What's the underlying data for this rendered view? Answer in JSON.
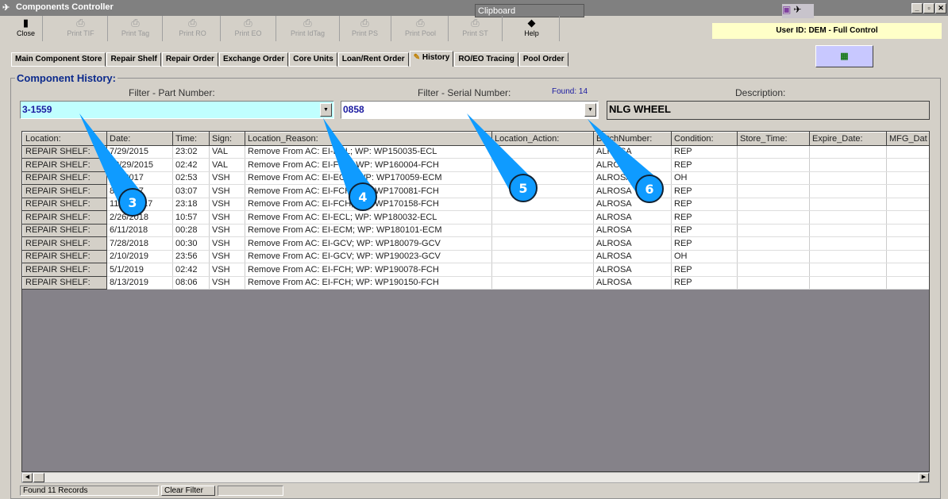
{
  "window": {
    "title": "Components Controller",
    "clipboard": "Clipboard",
    "minimize": "_",
    "restore": "▫",
    "close": "✕"
  },
  "toolbar": [
    {
      "label": "Close",
      "icon": "door-icon",
      "enabled": true
    },
    {
      "label": "Print TIF",
      "icon": "printer-icon",
      "enabled": false
    },
    {
      "label": "Print Tag",
      "icon": "printer-icon",
      "enabled": false
    },
    {
      "label": "Print RO",
      "icon": "printer-icon",
      "enabled": false
    },
    {
      "label": "Print EO",
      "icon": "printer-icon",
      "enabled": false
    },
    {
      "label": "Print IdTag",
      "icon": "printer-icon",
      "enabled": false
    },
    {
      "label": "Print PS",
      "icon": "printer-icon",
      "enabled": false
    },
    {
      "label": "Print Pool",
      "icon": "printer-icon",
      "enabled": false
    },
    {
      "label": "Print ST",
      "icon": "printer-icon",
      "enabled": false
    },
    {
      "label": "Help",
      "icon": "help-book-icon",
      "enabled": true
    }
  ],
  "user": "User ID: DEM - Full Control",
  "tabs": [
    "Main Component Store",
    "Repair Shelf",
    "Repair Order",
    "Exchange Order",
    "Core Units",
    "Loan/Rent Order",
    "History",
    "RO/EO Tracing",
    "Pool Order"
  ],
  "active_tab": "History",
  "group_title": "Component History:",
  "filters": {
    "part_label": "Filter - Part Number:",
    "part_value": "3-1559",
    "serial_label": "Filter - Serial Number:",
    "serial_value": "0858",
    "found": "Found: 14",
    "desc_label": "Description:",
    "desc_value": "NLG WHEEL"
  },
  "grid": {
    "columns": [
      "Location:",
      "Date:",
      "Time:",
      "Sign:",
      "Location_Reason:",
      "Location_Action:",
      "BatchNumber:",
      "Condition:",
      "Store_Time:",
      "Expire_Date:",
      "MFG_Dat"
    ],
    "rows": [
      [
        "REPAIR SHELF:",
        "7/29/2015",
        "23:02",
        "VAL",
        "Remove From AC: EI-ECL; WP: WP150035-ECL",
        "",
        "ALROSA",
        "REP",
        "",
        "",
        ""
      ],
      [
        "REPAIR SHELF:",
        "12/29/2015",
        "02:42",
        "VAL",
        "Remove From AC: EI-FCH; WP: WP160004-FCH",
        "",
        "ALROSA",
        "REP",
        "",
        "",
        ""
      ],
      [
        "REPAIR SHELF:",
        "3/6/2017",
        "02:53",
        "VSH",
        "Remove From AC: EI-ECM; WP: WP170059-ECM",
        "",
        "ALROSA",
        "OH",
        "",
        "",
        ""
      ],
      [
        "REPAIR SHELF:",
        "8/4/2017",
        "03:07",
        "VSH",
        "Remove From AC: EI-FCH; WP: WP170081-FCH",
        "",
        "ALROSA",
        "REP",
        "",
        "",
        ""
      ],
      [
        "REPAIR SHELF:",
        "11/14/2017",
        "23:18",
        "VSH",
        "Remove From AC: EI-FCH; WP: WP170158-FCH",
        "",
        "ALROSA",
        "REP",
        "",
        "",
        ""
      ],
      [
        "REPAIR SHELF:",
        "2/26/2018",
        "10:57",
        "VSH",
        "Remove From AC: EI-ECL; WP: WP180032-ECL",
        "",
        "ALROSA",
        "REP",
        "",
        "",
        ""
      ],
      [
        "REPAIR SHELF:",
        "6/11/2018",
        "00:28",
        "VSH",
        "Remove From AC: EI-ECM; WP: WP180101-ECM",
        "",
        "ALROSA",
        "REP",
        "",
        "",
        ""
      ],
      [
        "REPAIR SHELF:",
        "7/28/2018",
        "00:30",
        "VSH",
        "Remove From AC: EI-GCV; WP: WP180079-GCV",
        "",
        "ALROSA",
        "REP",
        "",
        "",
        ""
      ],
      [
        "REPAIR SHELF:",
        "2/10/2019",
        "23:56",
        "VSH",
        "Remove From AC: EI-GCV; WP: WP190023-GCV",
        "",
        "ALROSA",
        "OH",
        "",
        "",
        ""
      ],
      [
        "REPAIR SHELF:",
        "5/1/2019",
        "02:42",
        "VSH",
        "Remove From AC: EI-FCH; WP: WP190078-FCH",
        "",
        "ALROSA",
        "REP",
        "",
        "",
        ""
      ],
      [
        "REPAIR SHELF:",
        "8/13/2019",
        "08:06",
        "VSH",
        "Remove From AC: EI-FCH; WP: WP190150-FCH",
        "",
        "ALROSA",
        "REP",
        "",
        "",
        ""
      ]
    ]
  },
  "status": {
    "records": "Found 11 Records",
    "clear_filter": "Clear Filter"
  },
  "callouts": [
    "3",
    "4",
    "5",
    "6"
  ],
  "colors": {
    "callout": "#0f9bff",
    "part_bg": "#c0ffff",
    "user_bg": "#ffffc8",
    "title": "#0c2a8c"
  }
}
